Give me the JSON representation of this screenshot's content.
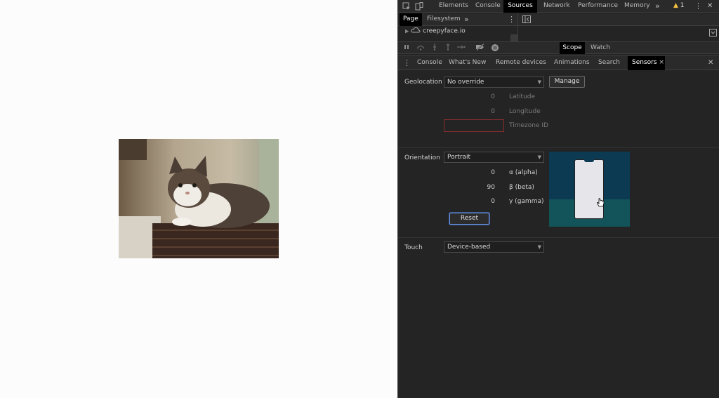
{
  "topbar": {
    "tabs": [
      {
        "label": "Elements",
        "active": false
      },
      {
        "label": "Console",
        "active": false
      },
      {
        "label": "Sources",
        "active": true
      },
      {
        "label": "Network",
        "active": false
      },
      {
        "label": "Performance",
        "active": false
      },
      {
        "label": "Memory",
        "active": false
      }
    ],
    "more": "»",
    "warning_count": "1"
  },
  "navigator": {
    "tabs": [
      {
        "label": "Page",
        "active": true
      },
      {
        "label": "Filesystem",
        "active": false
      }
    ],
    "more": "»",
    "tree_item": "creepyface.io"
  },
  "debugger": {
    "tabs": [
      {
        "label": "Scope",
        "active": true
      },
      {
        "label": "Watch",
        "active": false
      }
    ]
  },
  "drawer": {
    "tabs": [
      {
        "label": "Console",
        "active": false
      },
      {
        "label": "What's New",
        "active": false
      },
      {
        "label": "Remote devices",
        "active": false
      },
      {
        "label": "Animations",
        "active": false
      },
      {
        "label": "Search",
        "active": false
      },
      {
        "label": "Sensors",
        "active": true
      }
    ],
    "close_tab": "×",
    "close_drawer": "✕"
  },
  "sensors": {
    "geolocation": {
      "label": "Geolocation",
      "select_value": "No override",
      "manage_label": "Manage",
      "latitude_value": "0",
      "latitude_label": "Latitude",
      "longitude_value": "0",
      "longitude_label": "Longitude",
      "timezone_label": "Timezone ID"
    },
    "orientation": {
      "label": "Orientation",
      "select_value": "Portrait",
      "alpha_value": "0",
      "alpha_label": "α (alpha)",
      "beta_value": "90",
      "beta_label": "β (beta)",
      "gamma_value": "0",
      "gamma_label": "γ (gamma)",
      "reset_label": "Reset"
    },
    "touch": {
      "label": "Touch",
      "select_value": "Device-based"
    }
  },
  "colors": {
    "devtools_bg": "#242424",
    "active_tab_bg": "#000000",
    "warning": "#f5c341",
    "orientation_sky": "#0b3a52",
    "orientation_floor": "#12545a"
  }
}
